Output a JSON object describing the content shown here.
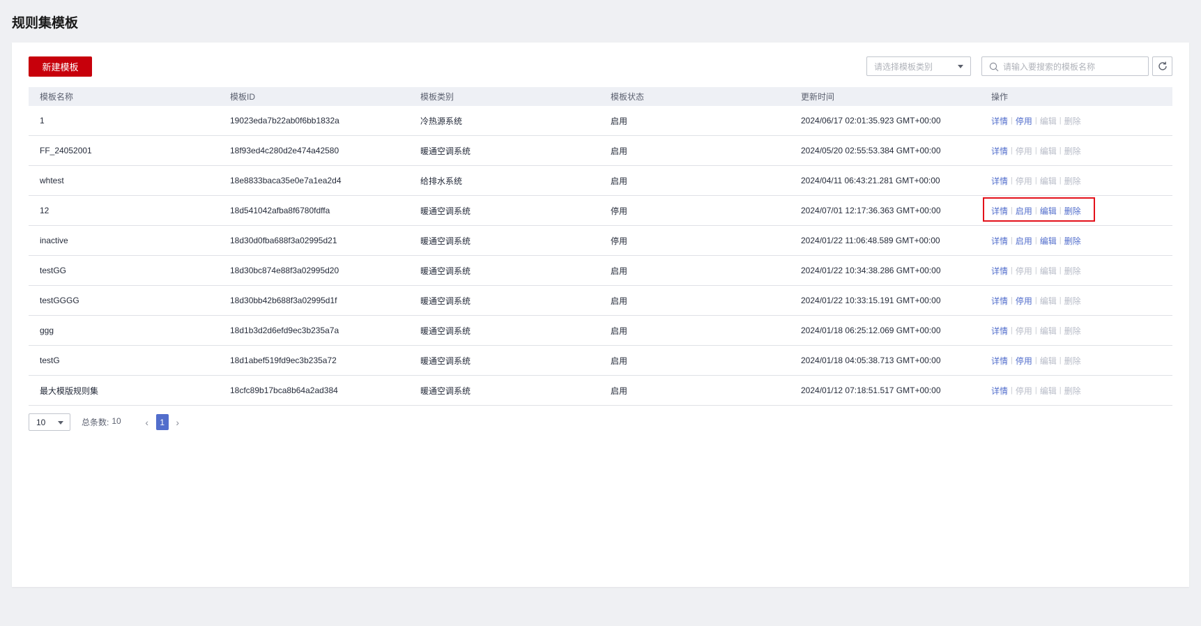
{
  "page": {
    "title": "规则集模板"
  },
  "toolbar": {
    "new_label": "新建模板",
    "type_placeholder": "请选择模板类别",
    "search_placeholder": "请输入要搜索的模板名称"
  },
  "table": {
    "headers": [
      "模板名称",
      "模板ID",
      "模板类别",
      "模板状态",
      "更新时间",
      "操作"
    ],
    "op_labels": {
      "detail": "详情",
      "enable": "启用",
      "disable": "停用",
      "edit": "编辑",
      "delete": "删除"
    },
    "rows": [
      {
        "name": "1",
        "id": "19023eda7b22ab0f6bb1832a",
        "category": "冷热源系统",
        "status": "启用",
        "updated": "2024/06/17 02:01:35.923 GMT+00:00",
        "toggle": "停用",
        "toggle_enabled": true,
        "edit_enabled": false,
        "delete_enabled": false
      },
      {
        "name": "FF_24052001",
        "id": "18f93ed4c280d2e474a42580",
        "category": "暖通空调系统",
        "status": "启用",
        "updated": "2024/05/20 02:55:53.384 GMT+00:00",
        "toggle": "停用",
        "toggle_enabled": false,
        "edit_enabled": false,
        "delete_enabled": false
      },
      {
        "name": "whtest",
        "id": "18e8833baca35e0e7a1ea2d4",
        "category": "给排水系统",
        "status": "启用",
        "updated": "2024/04/11 06:43:21.281 GMT+00:00",
        "toggle": "停用",
        "toggle_enabled": false,
        "edit_enabled": false,
        "delete_enabled": false
      },
      {
        "name": "12",
        "id": "18d541042afba8f6780fdffa",
        "category": "暖通空调系统",
        "status": "停用",
        "updated": "2024/07/01 12:17:36.363 GMT+00:00",
        "toggle": "启用",
        "toggle_enabled": true,
        "edit_enabled": true,
        "delete_enabled": true,
        "highlighted": true
      },
      {
        "name": "inactive",
        "id": "18d30d0fba688f3a02995d21",
        "category": "暖通空调系统",
        "status": "停用",
        "updated": "2024/01/22 11:06:48.589 GMT+00:00",
        "toggle": "启用",
        "toggle_enabled": true,
        "edit_enabled": true,
        "delete_enabled": true
      },
      {
        "name": "testGG",
        "id": "18d30bc874e88f3a02995d20",
        "category": "暖通空调系统",
        "status": "启用",
        "updated": "2024/01/22 10:34:38.286 GMT+00:00",
        "toggle": "停用",
        "toggle_enabled": false,
        "edit_enabled": false,
        "delete_enabled": false
      },
      {
        "name": "testGGGG",
        "id": "18d30bb42b688f3a02995d1f",
        "category": "暖通空调系统",
        "status": "启用",
        "updated": "2024/01/22 10:33:15.191 GMT+00:00",
        "toggle": "停用",
        "toggle_enabled": true,
        "edit_enabled": false,
        "delete_enabled": false
      },
      {
        "name": "ggg",
        "id": "18d1b3d2d6efd9ec3b235a7a",
        "category": "暖通空调系统",
        "status": "启用",
        "updated": "2024/01/18 06:25:12.069 GMT+00:00",
        "toggle": "停用",
        "toggle_enabled": false,
        "edit_enabled": false,
        "delete_enabled": false
      },
      {
        "name": "testG",
        "id": "18d1abef519fd9ec3b235a72",
        "category": "暖通空调系统",
        "status": "启用",
        "updated": "2024/01/18 04:05:38.713 GMT+00:00",
        "toggle": "停用",
        "toggle_enabled": true,
        "edit_enabled": false,
        "delete_enabled": false
      },
      {
        "name": "最大模版规则集",
        "id": "18cfc89b17bca8b64a2ad384",
        "category": "暖通空调系统",
        "status": "启用",
        "updated": "2024/01/12 07:18:51.517 GMT+00:00",
        "toggle": "停用",
        "toggle_enabled": false,
        "edit_enabled": false,
        "delete_enabled": false
      }
    ]
  },
  "pagination": {
    "page_size": "10",
    "total_label": "总条数:",
    "total_value": "10",
    "current_page": "1",
    "prev_icon": "chevron-left-icon",
    "next_icon": "chevron-right-icon"
  },
  "colors": {
    "brand_red": "#c7000b",
    "link_blue": "#526ecc",
    "disabled_gray": "#b8bcc8",
    "highlight_red": "#e3111a"
  }
}
